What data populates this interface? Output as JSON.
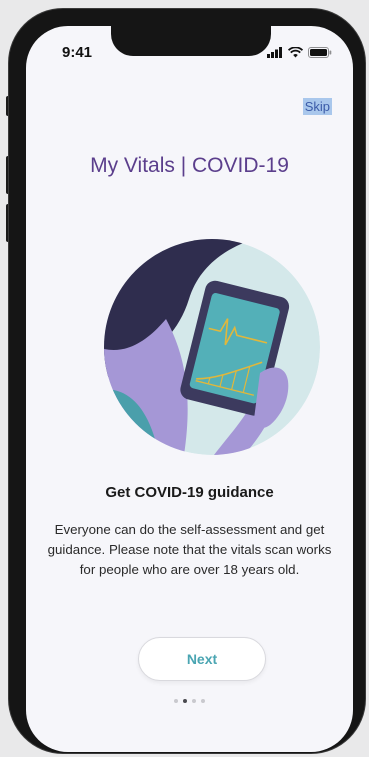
{
  "status_bar": {
    "time": "9:41"
  },
  "skip_label": "Skip",
  "title": "My Vitals | COVID-19",
  "heading": "Get COVID-19 guidance",
  "description": "Everyone can do the self-assessment and get guidance. Please note that the vitals scan works for people who are over 18 years old.",
  "next_label": "Next",
  "pagination": {
    "total": 4,
    "active_index": 1
  },
  "colors": {
    "title": "#5b3e8c",
    "next_text": "#4aa5b2",
    "circle_bg": "#d4e8ea",
    "hair": "#2f2d4e",
    "skin": "#a597d6",
    "device": "#3c3a5e",
    "screen": "#53b0b8",
    "chart_line": "#e0b73c"
  }
}
